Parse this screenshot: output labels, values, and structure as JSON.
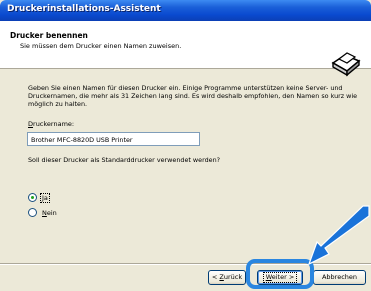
{
  "window": {
    "title": "Druckerinstallations-Assistent"
  },
  "header": {
    "title": "Drucker benennen",
    "subtitle": "Sie müssen dem Drucker einen Namen zuweisen."
  },
  "content": {
    "description": "Geben Sie einen Namen für diesen Drucker ein. Einige Programme unterstützen keine Server- und Druckernamen, die mehr als 31 Zeichen lang sind. Es wird deshalb empfohlen, den Namen so kurz wie möglich zu halten.",
    "printer_name_label_accel": "D",
    "printer_name_label_rest": "ruckername:",
    "printer_name_value": "Brother MFC-8820D USB Printer",
    "default_question": "Soll dieser Drucker als Standarddrucker verwendet werden?",
    "options": [
      {
        "accel": "J",
        "rest": "a",
        "selected": true
      },
      {
        "accel": "N",
        "rest": "ein",
        "selected": false
      }
    ]
  },
  "buttons": {
    "back": {
      "prefix": "< ",
      "accel": "Z",
      "rest": "urück"
    },
    "next": {
      "accel": "W",
      "rest": "eiter >"
    },
    "cancel": "Abbrechen"
  },
  "colors": {
    "titlebar": "#0a4ad0",
    "highlight": "#2a86e0"
  }
}
